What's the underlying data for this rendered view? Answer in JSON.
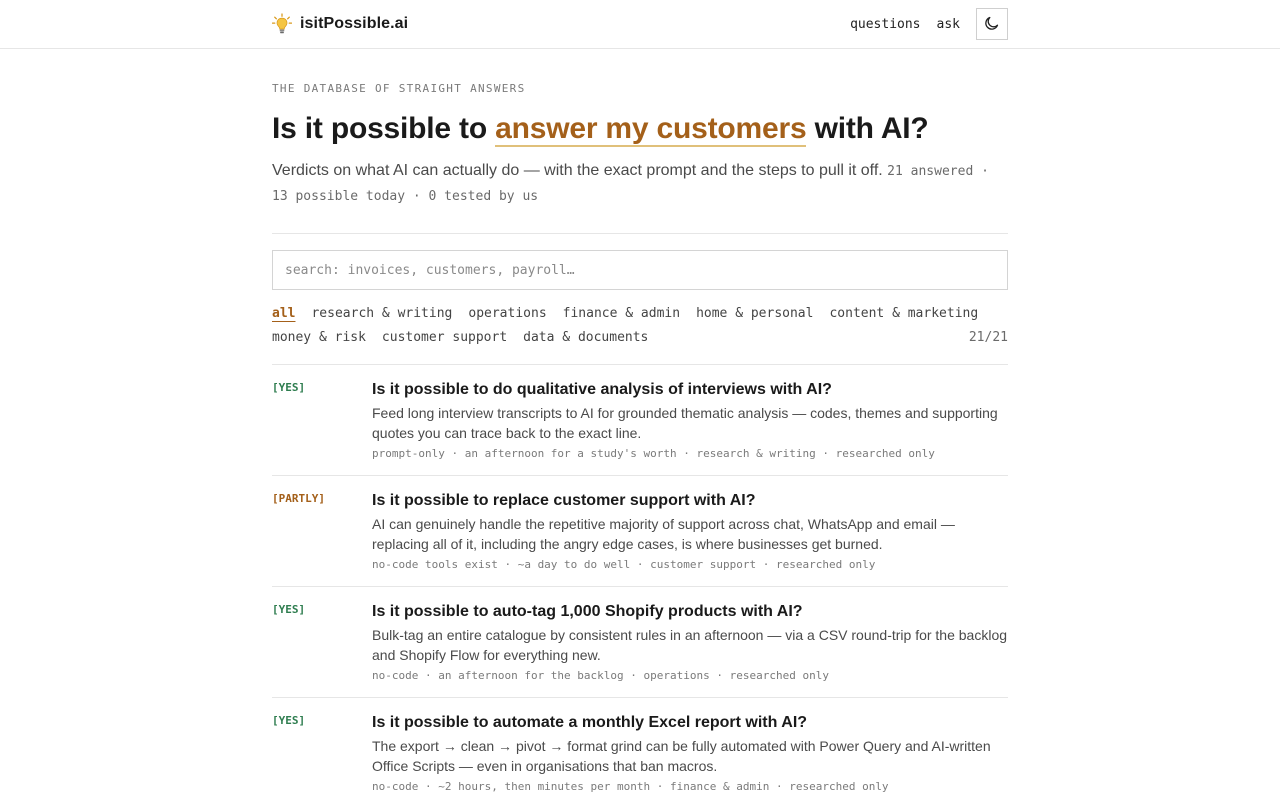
{
  "header": {
    "brand": "isitPossible.ai",
    "nav": [
      {
        "label": "questions"
      },
      {
        "label": "ask"
      }
    ]
  },
  "hero": {
    "eyebrow": "THE DATABASE OF STRAIGHT ANSWERS",
    "headline_prefix": "Is it possible to",
    "headline_highlight": "answer my customers",
    "headline_suffix": "with AI?",
    "subhead": "Verdicts on what AI can actually do — with the exact prompt and the steps to pull it off.",
    "stats": "21 answered · 13 possible today · 0 tested by us"
  },
  "search": {
    "placeholder": "search: invoices, customers, payroll…"
  },
  "filters": {
    "row1": [
      "all",
      "research & writing",
      "operations",
      "finance & admin",
      "home & personal",
      "content & marketing"
    ],
    "row2": [
      "money & risk",
      "customer support",
      "data & documents"
    ],
    "active": "all",
    "count": "21/21"
  },
  "questions": [
    {
      "verdict": "[YES]",
      "title": "Is it possible to do qualitative analysis of interviews with AI?",
      "desc": "Feed long interview transcripts to AI for grounded thematic analysis — codes, themes and supporting quotes you can trace back to the exact line.",
      "meta": "prompt-only · an afternoon for a study's worth · research & writing · researched only"
    },
    {
      "verdict": "[PARTLY]",
      "title": "Is it possible to replace customer support with AI?",
      "desc": "AI can genuinely handle the repetitive majority of support across chat, WhatsApp and email — replacing all of it, including the angry edge cases, is where businesses get burned.",
      "meta": "no-code tools exist · ~a day to do well · customer support · researched only"
    },
    {
      "verdict": "[YES]",
      "title": "Is it possible to auto-tag 1,000 Shopify products with AI?",
      "desc": "Bulk-tag an entire catalogue by consistent rules in an afternoon — via a CSV round-trip for the backlog and Shopify Flow for everything new.",
      "meta": "no-code · an afternoon for the backlog · operations · researched only"
    },
    {
      "verdict": "[YES]",
      "title": "Is it possible to automate a monthly Excel report with AI?",
      "desc": "The export → clean → pivot → format grind can be fully automated with Power Query and AI-written Office Scripts — even in organisations that ban macros.",
      "meta": "no-code · ~2 hours, then minutes per month · finance & admin · researched only"
    }
  ],
  "colors": {
    "accent": "#a4601a",
    "yes": "#2e7d4f",
    "partly": "#a4601a"
  },
  "icons": {
    "logo": "lightbulb-icon",
    "theme": "moon-icon"
  }
}
